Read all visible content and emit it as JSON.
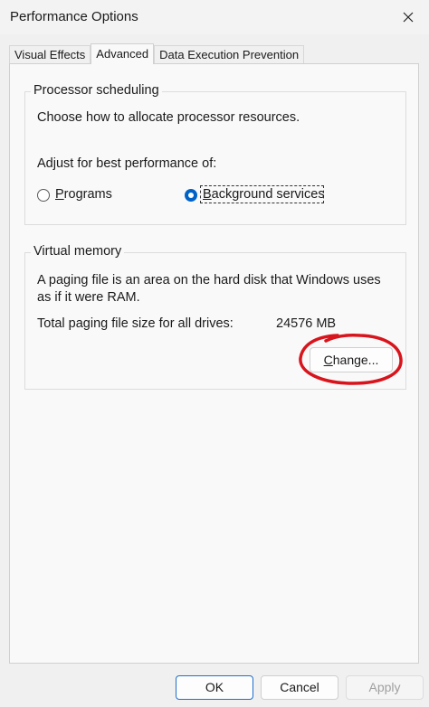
{
  "window": {
    "title": "Performance Options"
  },
  "tabs": [
    {
      "label": "Visual Effects"
    },
    {
      "label": "Advanced"
    },
    {
      "label": "Data Execution Prevention"
    }
  ],
  "processor": {
    "legend": "Processor scheduling",
    "description": "Choose how to allocate processor resources.",
    "adjust_label": "Adjust for best performance of:",
    "options": [
      {
        "hotkey": "P",
        "rest": "rograms",
        "selected": false
      },
      {
        "hotkey": "B",
        "rest": "ackground services",
        "selected": true
      }
    ]
  },
  "virtual_memory": {
    "legend": "Virtual memory",
    "description_line1": "A paging file is an area on the hard disk that Windows uses",
    "description_line2": "as if it were RAM.",
    "total_label": "Total paging file size for all drives:",
    "total_value": "24576 MB",
    "change_hotkey": "C",
    "change_rest": "hange...",
    "annotation_color": "#d8141c"
  },
  "footer": {
    "ok_label": "OK",
    "cancel_label": "Cancel",
    "apply_label": "Apply"
  },
  "colors": {
    "accent": "#0062c7",
    "annotation": "#d8141c"
  }
}
